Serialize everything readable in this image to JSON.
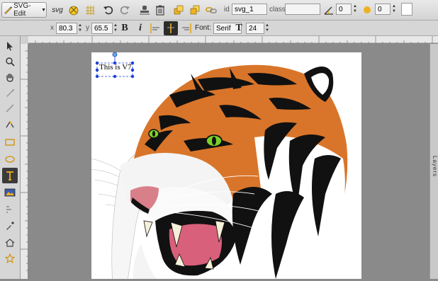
{
  "app": {
    "menu_label": "SVG-Edit"
  },
  "toolbar": {
    "svg_label": "svg",
    "id_label": "id",
    "id_value": "svg_1",
    "class_label": "class",
    "class_value": "",
    "angle_value": "0",
    "blur_value": "0"
  },
  "context": {
    "x_label": "x",
    "x_value": "80.3",
    "y_label": "y",
    "y_value": "65.5",
    "bold_label": "B",
    "italic_label": "i",
    "font_label": "Font:",
    "font_value": "Serif",
    "size_icon_label": "T",
    "font_size_value": "24"
  },
  "canvas": {
    "text_element": "This is V7"
  },
  "panels": {
    "layers_label": "Layers"
  },
  "colors": {
    "orange": "#d9752a",
    "black": "#111111",
    "selection": "#1a3fd6",
    "eye": "#7bd12a",
    "mouth": "#d9607a"
  }
}
